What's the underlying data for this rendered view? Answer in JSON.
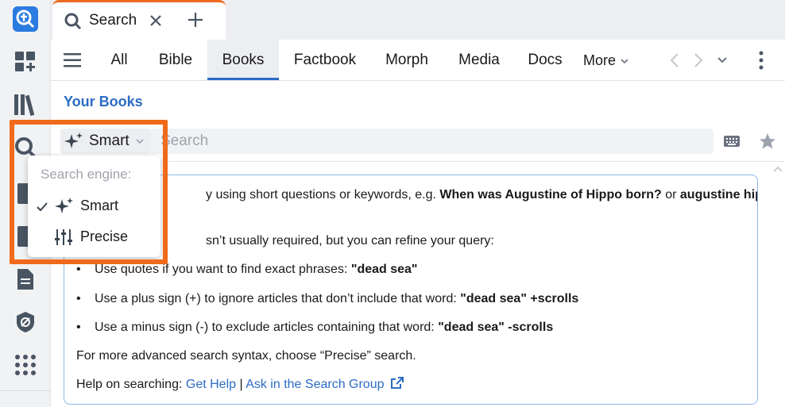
{
  "tab": {
    "title": "Search"
  },
  "nav": {
    "items": [
      "All",
      "Bible",
      "Books",
      "Factbook",
      "Morph",
      "Media",
      "Docs"
    ],
    "active": "Books",
    "more_label": "More"
  },
  "section": {
    "title": "Your Books"
  },
  "search": {
    "engine_label": "Smart",
    "placeholder": "Search"
  },
  "engine_menu": {
    "header": "Search engine:",
    "options": [
      {
        "label": "Smart",
        "selected": true,
        "icon": "sparkle-icon"
      },
      {
        "label": "Precise",
        "selected": false,
        "icon": "sliders-icon"
      }
    ]
  },
  "help": {
    "line1_pre": "y using short questions or keywords, e.g.",
    "line1_bold1": "When was Augustine of Hippo born?",
    "line1_mid": "or",
    "line1_bold2": "augustine hippo",
    "line2": "sn’t usually required, but you can refine your query:",
    "bullets": [
      {
        "text": "Use quotes if you want to find exact phrases:",
        "bold": "\"dead sea\""
      },
      {
        "text": "Use a plus sign (+) to ignore articles that don’t include that word:",
        "bold": "\"dead sea\" +scrolls"
      },
      {
        "text": "Use a minus sign (-) to exclude articles containing that word:",
        "bold": "\"dead sea\" -scrolls"
      }
    ],
    "advanced": "For more advanced search syntax, choose “Precise” search.",
    "help_prefix": "Help on searching:",
    "get_help": "Get Help",
    "separator": "|",
    "ask_group": "Ask in the Search Group"
  },
  "colors": {
    "accent": "#2b6cc4",
    "highlight": "#f06a1c",
    "tab_indicator": "#ee6b22"
  }
}
